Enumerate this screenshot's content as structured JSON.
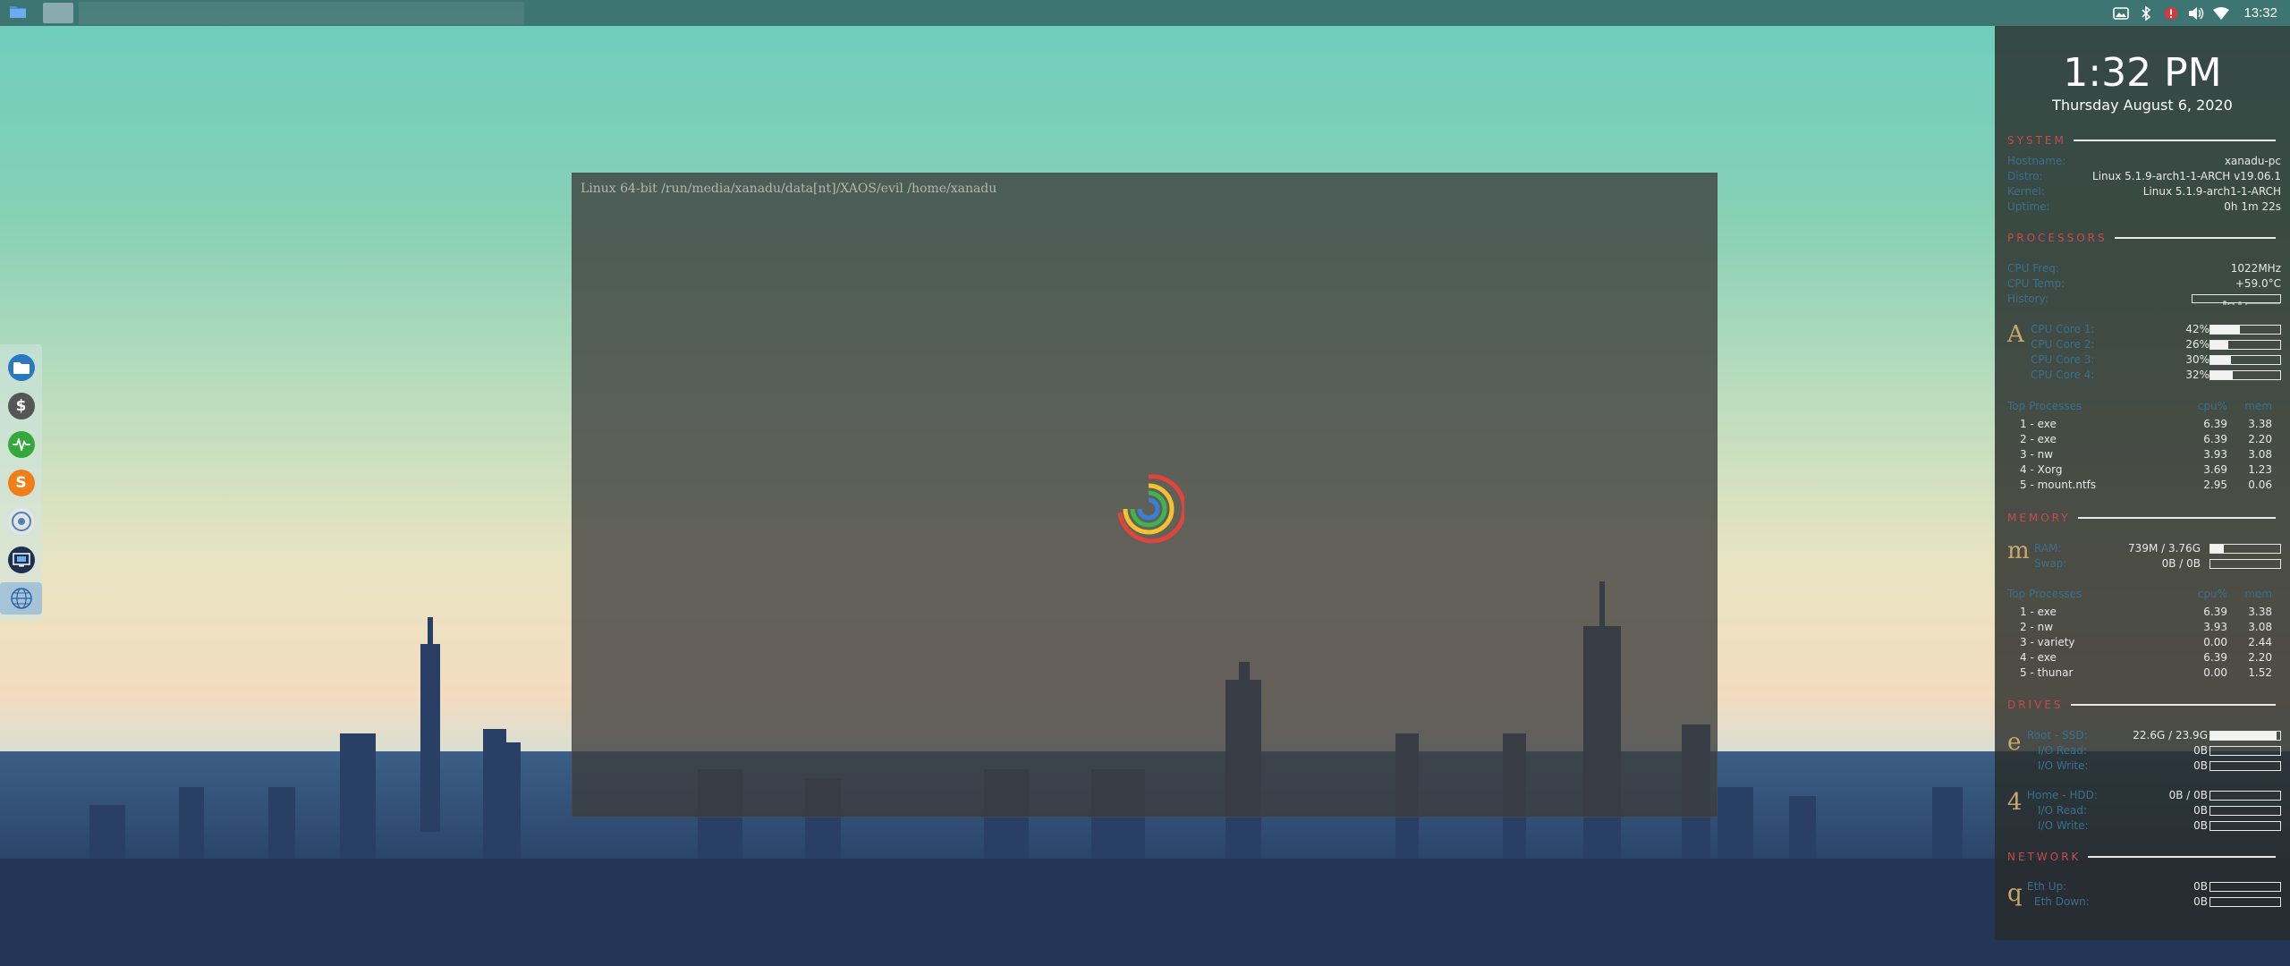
{
  "top_panel": {
    "launcher_icon": "folder-icon",
    "tray_icons": [
      "photo-icon",
      "bluetooth-icon",
      "alert-icon",
      "volume-icon",
      "wifi-icon"
    ],
    "clock": "13:32"
  },
  "dock": {
    "items": [
      {
        "name": "file-manager",
        "icon": "folder-icon"
      },
      {
        "name": "terminal",
        "icon": "terminal-icon"
      },
      {
        "name": "system-monitor",
        "icon": "activity-icon"
      },
      {
        "name": "sublime",
        "icon": "sublime-icon",
        "glyph": "S"
      },
      {
        "name": "chrome",
        "icon": "chrome-icon"
      },
      {
        "name": "screenshot",
        "icon": "screenshot-icon"
      },
      {
        "name": "browser",
        "icon": "globe-icon"
      }
    ]
  },
  "terminal": {
    "prompt": "Linux 64-bit /run/media/xanadu/data[nt]/XAOS/evil /home/xanadu"
  },
  "conky": {
    "time": "1:32 PM",
    "date": "Thursday August  6, 2020",
    "system": {
      "title": "SYSTEM",
      "rows": [
        {
          "label": "Hostname:",
          "value": "xanadu-pc"
        },
        {
          "label": "Distro:",
          "value": "Linux 5.1.9-arch1-1-ARCH v19.06.1"
        },
        {
          "label": "Kernel:",
          "value": "Linux 5.1.9-arch1-1-ARCH"
        },
        {
          "label": "Uptime:",
          "value": "0h 1m 22s"
        }
      ]
    },
    "processors": {
      "title": "PROCESSORS",
      "glyph": "A",
      "cpu_freq_label": "CPU Freq:",
      "cpu_freq": "1022MHz",
      "cpu_temp_label": "CPU Temp:",
      "cpu_temp": "+59.0°C",
      "history_label": "History:",
      "cores": [
        {
          "label": "CPU Core 1:",
          "value": "42%",
          "level": 0.42
        },
        {
          "label": "CPU Core 2:",
          "value": "26%",
          "level": 0.26
        },
        {
          "label": "CPU Core 3:",
          "value": "30%",
          "level": 0.3
        },
        {
          "label": "CPU Core 4:",
          "value": "32%",
          "level": 0.32
        }
      ],
      "top_header": {
        "name": "Top Processes",
        "c1": "cpu%",
        "c2": "mem"
      },
      "top": [
        {
          "rank": "1",
          "name": "exe",
          "cpu": "6.39",
          "mem": "3.38"
        },
        {
          "rank": "2",
          "name": "exe",
          "cpu": "6.39",
          "mem": "2.20"
        },
        {
          "rank": "3",
          "name": "nw",
          "cpu": "3.93",
          "mem": "3.08"
        },
        {
          "rank": "4",
          "name": "Xorg",
          "cpu": "3.69",
          "mem": "1.23"
        },
        {
          "rank": "5",
          "name": "mount.ntfs",
          "cpu": "2.95",
          "mem": "0.06"
        }
      ]
    },
    "memory": {
      "title": "MEMORY",
      "glyph": "m",
      "rows": [
        {
          "label": "RAM:",
          "value": "739M / 3.76G",
          "level": 0.19
        },
        {
          "label": "Swap:",
          "value": "0B / 0B",
          "level": 0
        }
      ],
      "top_header": {
        "name": "Top Processes",
        "c1": "cpu%",
        "c2": "mem"
      },
      "top": [
        {
          "rank": "1",
          "name": "exe",
          "cpu": "6.39",
          "mem": "3.38"
        },
        {
          "rank": "2",
          "name": "nw",
          "cpu": "3.93",
          "mem": "3.08"
        },
        {
          "rank": "3",
          "name": "variety",
          "cpu": "0.00",
          "mem": "2.44"
        },
        {
          "rank": "4",
          "name": "exe",
          "cpu": "6.39",
          "mem": "2.20"
        },
        {
          "rank": "5",
          "name": "thunar",
          "cpu": "0.00",
          "mem": "1.52"
        }
      ]
    },
    "drives": {
      "title": "DRIVES",
      "glyph1": "e",
      "glyph2": "4",
      "rows1": [
        {
          "label": "Root - SSD:",
          "value": "22.6G / 23.9G",
          "level": 0.95
        },
        {
          "label": "I/O Read:",
          "value": "0B",
          "level": 0
        },
        {
          "label": "I/O Write:",
          "value": "0B",
          "level": 0
        }
      ],
      "rows2": [
        {
          "label": "Home - HDD:",
          "value": "0B / 0B",
          "level": 0
        },
        {
          "label": "I/O Read:",
          "value": "0B",
          "level": 0
        },
        {
          "label": "I/O Write:",
          "value": "0B",
          "level": 0
        }
      ]
    },
    "network": {
      "title": "NETWORK",
      "glyph": "q",
      "rows": [
        {
          "label": "Eth Up:",
          "value": "0B",
          "level": 0
        },
        {
          "label": "Eth Down:",
          "value": "0B",
          "level": 0
        }
      ]
    }
  }
}
